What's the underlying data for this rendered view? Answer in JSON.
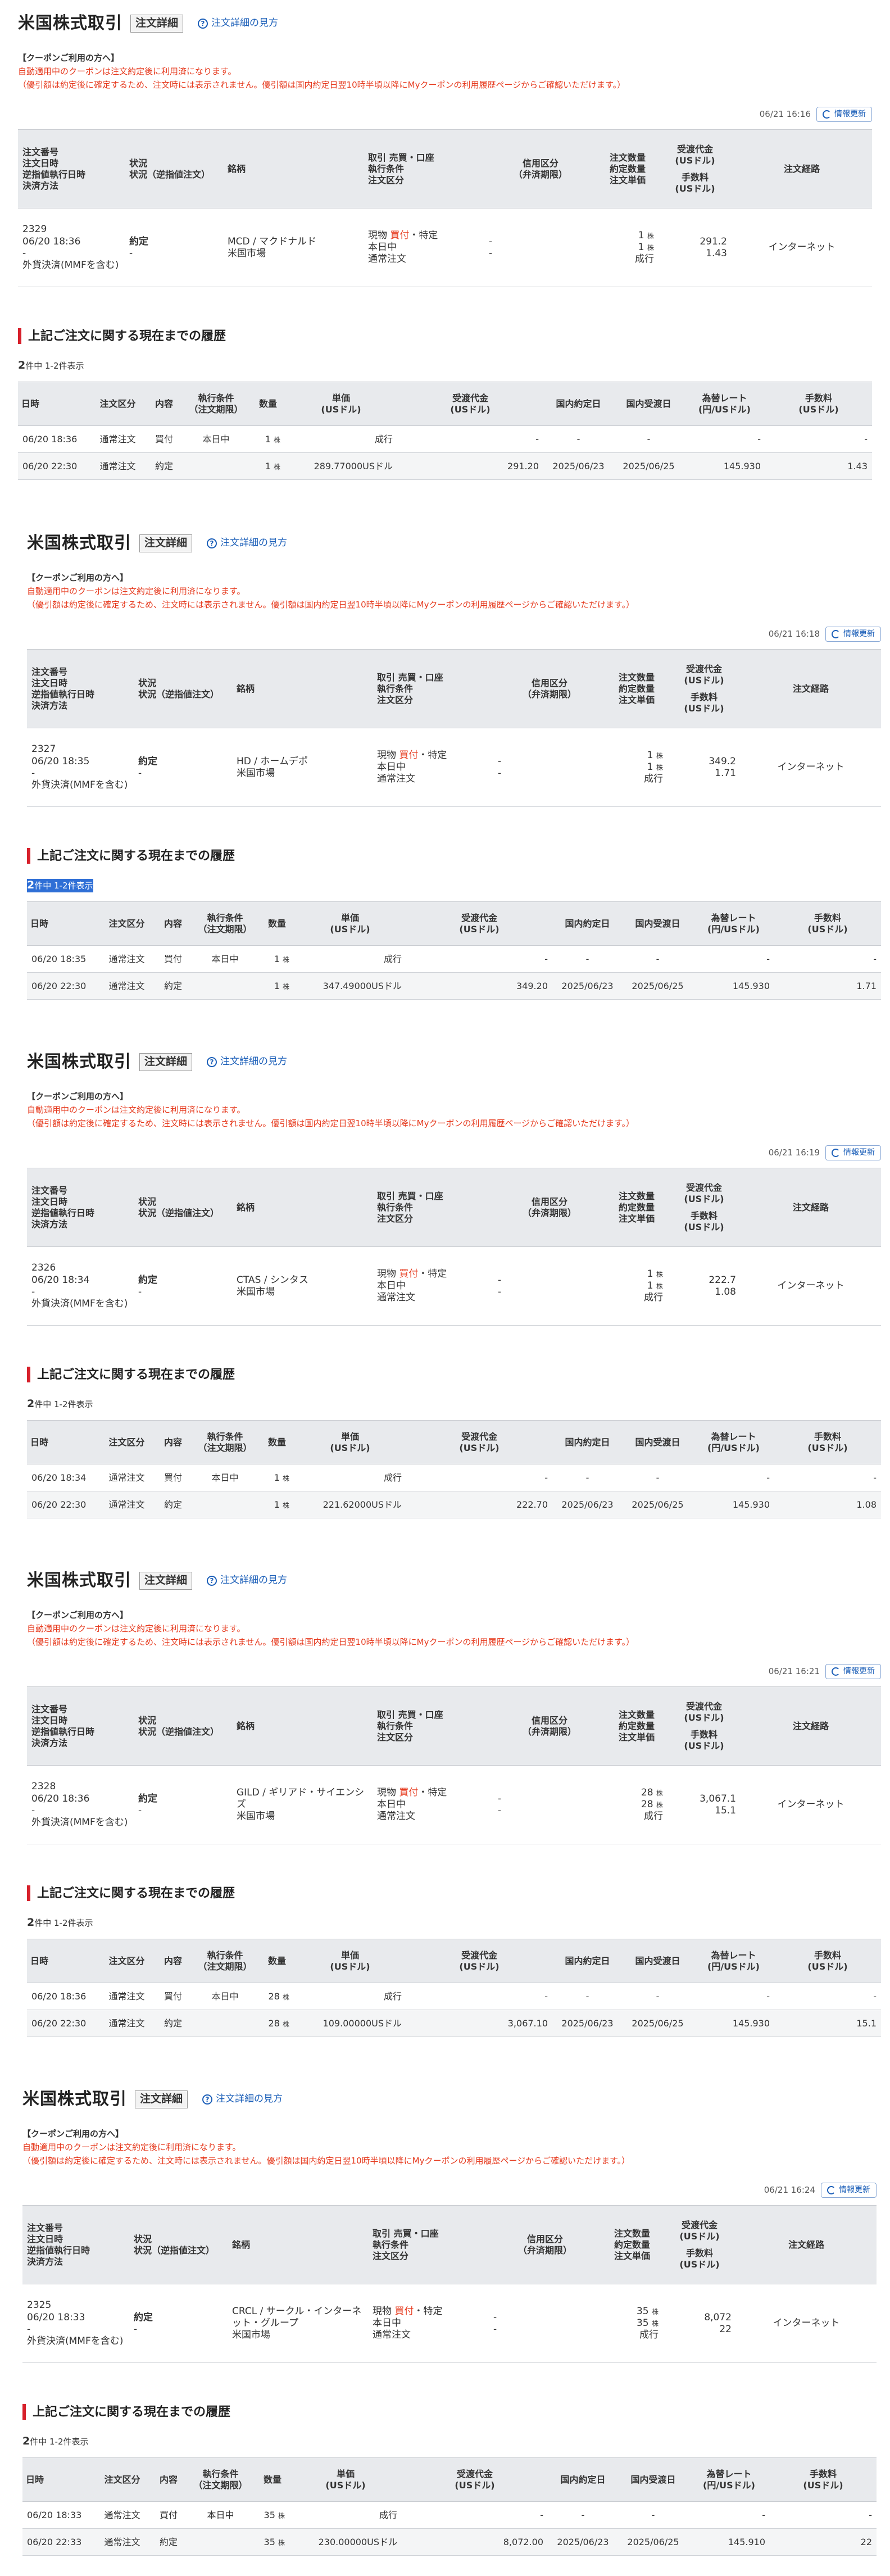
{
  "common": {
    "title": "米国株式取引",
    "badge": "注文詳細",
    "help_link": "注文詳細の見方",
    "coupon_heading": "【クーポンご利用の方へ】",
    "coupon_line1": "自動適用中のクーポンは注文約定後に利用済になります。",
    "coupon_line2": "（優引額は約定後に確定するため、注文時には表示されません。優引額は国内約定日翌10時半頃以降にMyクーポンの利用履歴ページからご確認いただけます。）",
    "update_button": "情報更新",
    "history_heading": "上記ご注文に関する現在までの履歴",
    "count_big": "2",
    "count_rest": "件中 1-2件表示",
    "order_headers": {
      "col1": [
        "注文番号",
        "注文日時",
        "逆指値執行日時",
        "決済方法"
      ],
      "col2": [
        "状況",
        "状況（逆指値注文）"
      ],
      "col3": [
        "銘柄"
      ],
      "col4": [
        "取引 売買・口座",
        "執行条件",
        "注文区分"
      ],
      "col5": [
        "信用区分",
        "（弁済期限）"
      ],
      "col6": [
        "注文数量",
        "約定数量",
        "注文単価"
      ],
      "col7a": [
        "受渡代金",
        "(USドル)"
      ],
      "col7b": [
        "手数料",
        "(USドル)"
      ],
      "col8": [
        "注文経路"
      ]
    },
    "history_headers": {
      "date": "日時",
      "order_type": "注文区分",
      "content": "内容",
      "exec_cond": [
        "執行条件",
        "（注文期限）"
      ],
      "qty": "数量",
      "price": [
        "単価",
        "(USドル)"
      ],
      "amount": [
        "受渡代金",
        "(USドル)"
      ],
      "domestic_exec": "国内約定日",
      "domestic_settle": "国内受渡日",
      "fx_rate": [
        "為替レート",
        "(円/USドル)"
      ],
      "fee": [
        "手数料",
        "(USドル)"
      ]
    },
    "unit": "株",
    "dash": "-"
  },
  "orders": [
    {
      "timestamp": "06/21 16:16",
      "order_no": "2329",
      "order_datetime": "06/20 18:36",
      "stop_exec": "-",
      "settlement": "外貨決済(MMFを含む)",
      "status": "約定",
      "status_stop": "-",
      "symbol": "MCD / マクドナルド",
      "market": "米国市場",
      "trade_prefix": "現物",
      "trade_side": "買付",
      "trade_suffix": "・特定",
      "exec_cond": "本日中",
      "order_class": "通常注文",
      "margin1": "-",
      "margin2": "-",
      "order_qty": "1",
      "filled_qty": "1",
      "unit_price": "成行",
      "amount": "291.2",
      "fee": "1.43",
      "route": "インターネット",
      "history": [
        {
          "date": "06/20 18:36",
          "order_type": "通常注文",
          "content": "買付",
          "exec_cond": "本日中",
          "qty": "1",
          "price": "成行",
          "amount": "-",
          "domestic_exec": "-",
          "domestic_settle": "-",
          "fx_rate": "-",
          "fee": "-"
        },
        {
          "date": "06/20 22:30",
          "order_type": "通常注文",
          "content": "約定",
          "exec_cond": "",
          "qty": "1",
          "price": "289.77000USドル",
          "amount": "291.20",
          "domestic_exec": "2025/06/23",
          "domestic_settle": "2025/06/25",
          "fx_rate": "145.930",
          "fee": "1.43"
        }
      ]
    },
    {
      "timestamp": "06/21 16:18",
      "order_no": "2327",
      "order_datetime": "06/20 18:35",
      "stop_exec": "-",
      "settlement": "外貨決済(MMFを含む)",
      "status": "約定",
      "status_stop": "-",
      "symbol": "HD / ホームデポ",
      "market": "米国市場",
      "trade_prefix": "現物",
      "trade_side": "買付",
      "trade_suffix": "・特定",
      "exec_cond": "本日中",
      "order_class": "通常注文",
      "margin1": "-",
      "margin2": "-",
      "order_qty": "1",
      "filled_qty": "1",
      "unit_price": "成行",
      "amount": "349.2",
      "fee": "1.71",
      "route": "インターネット",
      "history": [
        {
          "date": "06/20 18:35",
          "order_type": "通常注文",
          "content": "買付",
          "exec_cond": "本日中",
          "qty": "1",
          "price": "成行",
          "amount": "-",
          "domestic_exec": "-",
          "domestic_settle": "-",
          "fx_rate": "-",
          "fee": "-"
        },
        {
          "date": "06/20 22:30",
          "order_type": "通常注文",
          "content": "約定",
          "exec_cond": "",
          "qty": "1",
          "price": "347.49000USドル",
          "amount": "349.20",
          "domestic_exec": "2025/06/23",
          "domestic_settle": "2025/06/25",
          "fx_rate": "145.930",
          "fee": "1.71"
        }
      ]
    },
    {
      "timestamp": "06/21 16:19",
      "order_no": "2326",
      "order_datetime": "06/20 18:34",
      "stop_exec": "-",
      "settlement": "外貨決済(MMFを含む)",
      "status": "約定",
      "status_stop": "-",
      "symbol": "CTAS / シンタス",
      "market": "米国市場",
      "trade_prefix": "現物",
      "trade_side": "買付",
      "trade_suffix": "・特定",
      "exec_cond": "本日中",
      "order_class": "通常注文",
      "margin1": "-",
      "margin2": "-",
      "order_qty": "1",
      "filled_qty": "1",
      "unit_price": "成行",
      "amount": "222.7",
      "fee": "1.08",
      "route": "インターネット",
      "history": [
        {
          "date": "06/20 18:34",
          "order_type": "通常注文",
          "content": "買付",
          "exec_cond": "本日中",
          "qty": "1",
          "price": "成行",
          "amount": "-",
          "domestic_exec": "-",
          "domestic_settle": "-",
          "fx_rate": "-",
          "fee": "-"
        },
        {
          "date": "06/20 22:30",
          "order_type": "通常注文",
          "content": "約定",
          "exec_cond": "",
          "qty": "1",
          "price": "221.62000USドル",
          "amount": "222.70",
          "domestic_exec": "2025/06/23",
          "domestic_settle": "2025/06/25",
          "fx_rate": "145.930",
          "fee": "1.08"
        }
      ]
    },
    {
      "timestamp": "06/21 16:21",
      "order_no": "2328",
      "order_datetime": "06/20 18:36",
      "stop_exec": "-",
      "settlement": "外貨決済(MMFを含む)",
      "status": "約定",
      "status_stop": "-",
      "symbol": "GILD / ギリアド・サイエンシズ",
      "market": "米国市場",
      "trade_prefix": "現物",
      "trade_side": "買付",
      "trade_suffix": "・特定",
      "exec_cond": "本日中",
      "order_class": "通常注文",
      "margin1": "-",
      "margin2": "-",
      "order_qty": "28",
      "filled_qty": "28",
      "unit_price": "成行",
      "amount": "3,067.1",
      "fee": "15.1",
      "route": "インターネット",
      "history": [
        {
          "date": "06/20 18:36",
          "order_type": "通常注文",
          "content": "買付",
          "exec_cond": "本日中",
          "qty": "28",
          "price": "成行",
          "amount": "-",
          "domestic_exec": "-",
          "domestic_settle": "-",
          "fx_rate": "-",
          "fee": "-"
        },
        {
          "date": "06/20 22:30",
          "order_type": "通常注文",
          "content": "約定",
          "exec_cond": "",
          "qty": "28",
          "price": "109.00000USドル",
          "amount": "3,067.10",
          "domestic_exec": "2025/06/23",
          "domestic_settle": "2025/06/25",
          "fx_rate": "145.930",
          "fee": "15.1"
        }
      ]
    },
    {
      "timestamp": "06/21 16:24",
      "order_no": "2325",
      "order_datetime": "06/20 18:33",
      "stop_exec": "-",
      "settlement": "外貨決済(MMFを含む)",
      "status": "約定",
      "status_stop": "-",
      "symbol": "CRCL / サークル・インターネット・グループ",
      "market": "米国市場",
      "trade_prefix": "現物",
      "trade_side": "買付",
      "trade_suffix": "・特定",
      "exec_cond": "本日中",
      "order_class": "通常注文",
      "margin1": "-",
      "margin2": "-",
      "order_qty": "35",
      "filled_qty": "35",
      "unit_price": "成行",
      "amount": "8,072",
      "fee": "22",
      "route": "インターネット",
      "history": [
        {
          "date": "06/20 18:33",
          "order_type": "通常注文",
          "content": "買付",
          "exec_cond": "本日中",
          "qty": "35",
          "price": "成行",
          "amount": "-",
          "domestic_exec": "-",
          "domestic_settle": "-",
          "fx_rate": "-",
          "fee": "-"
        },
        {
          "date": "06/20 22:33",
          "order_type": "通常注文",
          "content": "約定",
          "exec_cond": "",
          "qty": "35",
          "price": "230.00000USドル",
          "amount": "8,072.00",
          "domestic_exec": "2025/06/23",
          "domestic_settle": "2025/06/25",
          "fx_rate": "145.910",
          "fee": "22"
        }
      ]
    }
  ]
}
